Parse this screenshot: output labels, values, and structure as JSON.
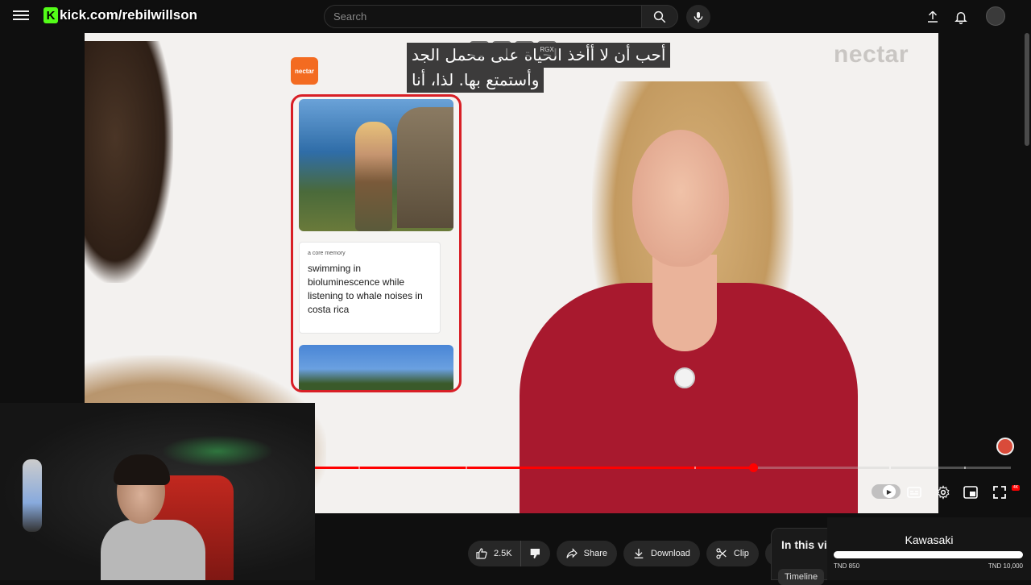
{
  "header": {
    "brand_k": "K",
    "brand_text": "kick.com/rebilwillson",
    "search_placeholder": "Search"
  },
  "icons": {
    "menu": "hamburger-menu-icon",
    "search": "search-icon",
    "mic": "microphone-icon",
    "upload": "upload-icon",
    "notifications": "bell-icon"
  },
  "video": {
    "subtitle_line1": "أحب أن لا أأخذ الحياة على محمل الجد",
    "subtitle_line2": "وأستمتع بها. لذا، أنا",
    "mini_controls": [
      "",
      "",
      "",
      "RGX"
    ],
    "watermark": "nectar",
    "logo_text": "nectar",
    "card_kicker": "a core memory",
    "card_text": "swimming in bioluminescence while listening to whale noises in costa rica",
    "progress_fraction": 0.63,
    "segment_fractions": [
      0.063,
      0.217,
      0.545,
      0.825,
      0.933
    ],
    "hd_badge": "4K",
    "accent_color": "#ff0000"
  },
  "actions": {
    "like_count": "2.5K",
    "share_label": "Share",
    "download_label": "Download",
    "clip_label": "Clip",
    "more_label": "⋯"
  },
  "side_panel": {
    "title": "In this vi",
    "chip": "Timeline"
  },
  "goal_widget": {
    "title": "Kawasaki",
    "min_label": "TND 850",
    "max_label": "TND 10,000",
    "fraction": 0.0,
    "fill_color": "#9acd32"
  }
}
